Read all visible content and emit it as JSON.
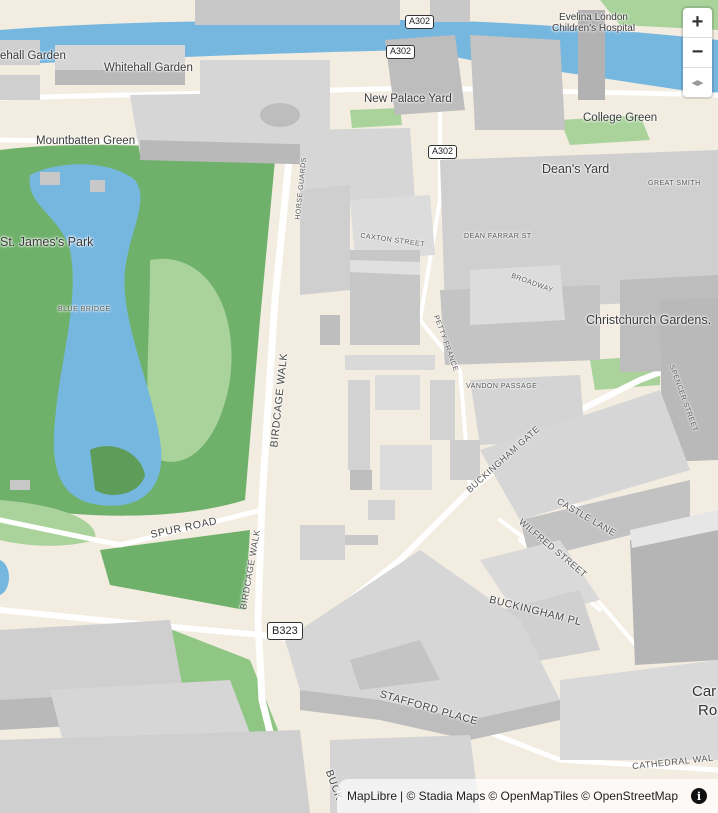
{
  "map": {
    "labels": {
      "whitehall_gardens_left": "ehall Garden",
      "whitehall_gardens": "Whitehall Garden",
      "mountbatten_green": "Mountbatten Green",
      "st_james_park": "St. James's Park",
      "new_palace_yard": "New Palace Yard",
      "evelina": "Evelina London\nChildren's Hospital",
      "college_green": "College Green",
      "deans_yard": "Dean's Yard",
      "christchurch": "Christchurch Gardens.",
      "car_partial": "Car",
      "ro_partial": "Ro"
    },
    "streets": {
      "birdcage_walk": "BIRDCAGE WALK",
      "birdcage_walk_2": "BIRDCAGE WALK",
      "spur_road": "SPUR ROAD",
      "buckingham_gate": "BUCKINGHAM GATE",
      "castle_lane": "CASTLE LANE",
      "wilfred_street": "WILFRED STREET",
      "buckingham_place": "BUCKINGHAM PL",
      "stafford_place": "STAFFORD PLACE",
      "cathedral_walk": "CATHEDRAL WAL",
      "petty_france": "PETTY FRANCE",
      "vandon_passage": "VANDON PASSAGE",
      "spencer_street": "SPENCER STREET",
      "broadway": "BROADWAY",
      "dean_farrar": "DEAN FARRAR ST",
      "caxton_street": "CAXTON STREET",
      "horseguards": "HORSE GUARDS",
      "blue_bridge": "BLUE BRIDGE",
      "great_smith": "GREAT SMITH",
      "bucks": "BUCK"
    },
    "shields": {
      "a302_top": "A302",
      "a302_mid": "A302",
      "a302_low": "A302",
      "b323": "B323"
    },
    "colors": {
      "land": "#f3ece1",
      "park": "#6fb16b",
      "park_light": "#a9d39b",
      "water": "#76b7e0",
      "building": "#cfcfcf",
      "building_top": "#e3e3e3",
      "road": "#ffffff"
    }
  },
  "controls": {
    "zoom_in": "+",
    "zoom_out": "−",
    "compass": "◂▸"
  },
  "attribution": {
    "maplibre": "MapLibre",
    "stadia": "| © Stadia Maps",
    "omt": "© OpenMapTiles",
    "osm": "© OpenStreetMap",
    "info": "i"
  }
}
